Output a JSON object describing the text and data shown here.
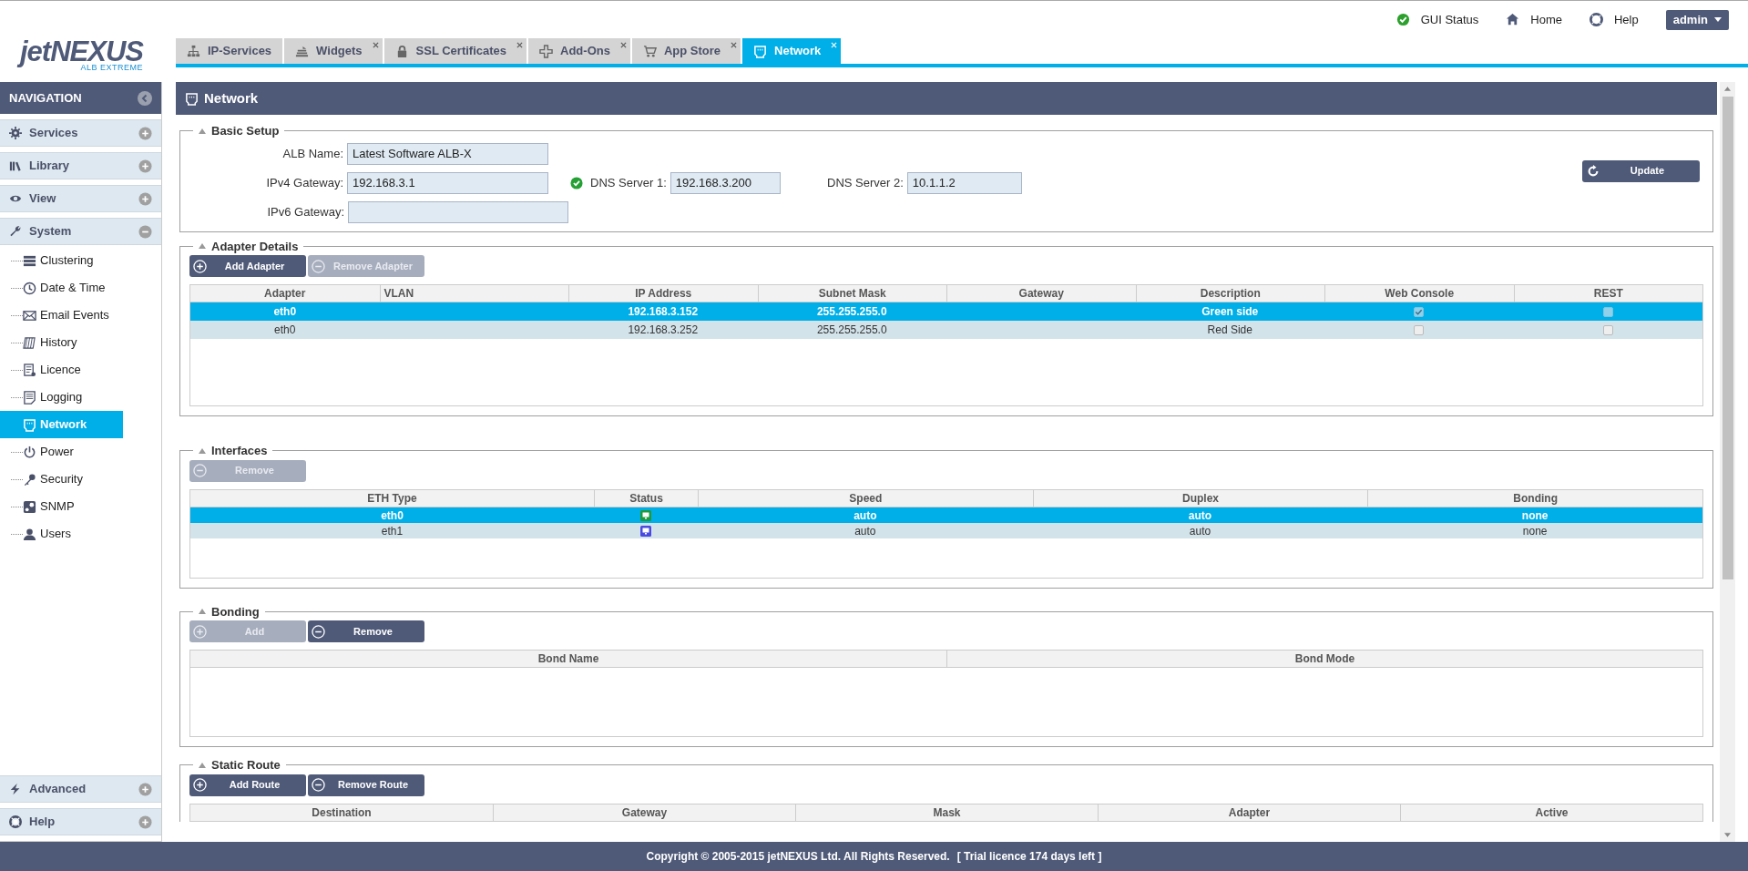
{
  "logo": {
    "brand": "jetNEXUS",
    "tagline": "ALB EXTREME"
  },
  "top_links": [
    {
      "label": "GUI Status",
      "kind": "status"
    },
    {
      "label": "Home",
      "kind": "home"
    },
    {
      "label": "Help",
      "kind": "help"
    }
  ],
  "user_menu": {
    "label": "admin"
  },
  "tabs": [
    {
      "label": "IP-Services",
      "kind": "sitemap",
      "closable": false,
      "selected": false
    },
    {
      "label": "Widgets",
      "kind": "widgets",
      "closable": true,
      "selected": false
    },
    {
      "label": "SSL Certificates",
      "kind": "lock",
      "closable": true,
      "selected": false
    },
    {
      "label": "Add-Ons",
      "kind": "addons",
      "closable": true,
      "selected": false
    },
    {
      "label": "App Store",
      "kind": "cart",
      "closable": true,
      "selected": false
    },
    {
      "label": "Network",
      "kind": "network",
      "closable": true,
      "selected": true
    }
  ],
  "navigation": {
    "title": "NAVIGATION",
    "sections": [
      {
        "label": "Services",
        "kind": "gear",
        "expanded": false
      },
      {
        "label": "Library",
        "kind": "library",
        "expanded": false
      },
      {
        "label": "View",
        "kind": "view",
        "expanded": false
      },
      {
        "label": "System",
        "kind": "system",
        "expanded": true,
        "children": [
          {
            "label": "Clustering",
            "kind": "clustering",
            "selected": false
          },
          {
            "label": "Date & Time",
            "kind": "clock",
            "selected": false
          },
          {
            "label": "Email Events",
            "kind": "email",
            "selected": false
          },
          {
            "label": "History",
            "kind": "history",
            "selected": false
          },
          {
            "label": "Licence",
            "kind": "licence",
            "selected": false
          },
          {
            "label": "Logging",
            "kind": "logging",
            "selected": false
          },
          {
            "label": "Network",
            "kind": "network",
            "selected": true
          },
          {
            "label": "Power",
            "kind": "power",
            "selected": false
          },
          {
            "label": "Security",
            "kind": "security",
            "selected": false
          },
          {
            "label": "SNMP",
            "kind": "snmp",
            "selected": false
          },
          {
            "label": "Users",
            "kind": "users",
            "selected": false
          }
        ]
      },
      {
        "label": "Advanced",
        "kind": "advanced",
        "expanded": false
      },
      {
        "label": "Help",
        "kind": "help",
        "expanded": false
      }
    ]
  },
  "page": {
    "title": "Network"
  },
  "basic_setup": {
    "title": "Basic Setup",
    "alb_name": {
      "label": "ALB Name:",
      "value": "Latest Software ALB-X"
    },
    "ipv4_gateway": {
      "label": "IPv4 Gateway:",
      "value": "192.168.3.1",
      "verified": true
    },
    "dns_server_1": {
      "label": "DNS Server 1:",
      "value": "192.168.3.200"
    },
    "dns_server_2": {
      "label": "DNS Server 2:",
      "value": "10.1.1.2"
    },
    "ipv6_gateway": {
      "label": "IPv6 Gateway:"
    },
    "update_button": "Update"
  },
  "adapter_details": {
    "title": "Adapter Details",
    "buttons": [
      {
        "label": "Add Adapter",
        "kind": "add",
        "disabled": false
      },
      {
        "label": "Remove Adapter",
        "kind": "remove",
        "disabled": true
      }
    ],
    "columns": [
      "Adapter",
      "VLAN",
      "IP Address",
      "Subnet Mask",
      "Gateway",
      "Description",
      "Web Console",
      "REST"
    ],
    "rows": [
      {
        "selected": true,
        "adapter": "eth0",
        "ip_address": "192.168.3.152",
        "subnet_mask": "255.255.255.0",
        "description": "Green side",
        "web_console": true,
        "rest": false
      },
      {
        "selected": false,
        "adapter": "eth0",
        "ip_address": "192.168.3.252",
        "subnet_mask": "255.255.255.0",
        "description": "Red Side",
        "web_console": false,
        "rest": false
      }
    ]
  },
  "interfaces": {
    "title": "Interfaces",
    "buttons": [
      {
        "label": "Remove",
        "kind": "remove",
        "disabled": true
      }
    ],
    "columns": [
      "ETH Type",
      "Status",
      "Speed",
      "Duplex",
      "Bonding"
    ],
    "rows": [
      {
        "selected": true,
        "eth_type": "eth0",
        "color": "#1e9a3c",
        "speed": "auto",
        "duplex": "auto",
        "bonding": "none"
      },
      {
        "selected": false,
        "eth_type": "eth1",
        "color": "#4a4ae0",
        "speed": "auto",
        "duplex": "auto",
        "bonding": "none"
      }
    ]
  },
  "bonding": {
    "title": "Bonding",
    "buttons": [
      {
        "label": "Add",
        "kind": "add",
        "disabled": true
      },
      {
        "label": "Remove",
        "kind": "remove",
        "disabled": false
      }
    ],
    "columns": [
      "Bond Name",
      "Bond Mode"
    ]
  },
  "static_route": {
    "title": "Static Route",
    "buttons": [
      {
        "label": "Add Route",
        "kind": "add",
        "disabled": false
      },
      {
        "label": "Remove Route",
        "kind": "remove",
        "disabled": false
      }
    ],
    "columns": [
      "Destination",
      "Gateway",
      "Mask",
      "Adapter",
      "Active"
    ]
  },
  "footer": {
    "copyright": "Copyright © 2005-2015 jetNEXUS Ltd. All Rights Reserved.",
    "licence": "[ Trial licence 174 days left ]"
  }
}
